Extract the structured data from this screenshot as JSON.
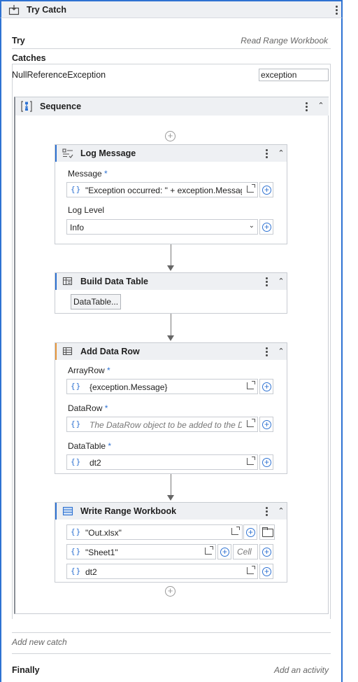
{
  "try_catch": {
    "title": "Try Catch",
    "icon": "try-catch-icon",
    "try_label": "Try",
    "try_activity": "Read Range Workbook",
    "catches_label": "Catches",
    "exception_type": "NullReferenceException",
    "exception_var": "exception",
    "add_new_catch": "Add new catch",
    "finally_label": "Finally",
    "finally_placeholder": "Add an activity"
  },
  "sequence": {
    "title": "Sequence",
    "icon": "sequence-icon"
  },
  "log_message": {
    "title": "Log Message",
    "icon": "log-message-icon",
    "message_label": "Message",
    "required_mark": "*",
    "message_value": "\"Exception occurred: \" + exception.Messag",
    "log_level_label": "Log Level",
    "log_level_value": "Info"
  },
  "build_data_table": {
    "title": "Build Data Table",
    "icon": "build-data-table-icon",
    "button_label": "DataTable..."
  },
  "add_data_row": {
    "title": "Add Data Row",
    "icon": "add-data-row-icon",
    "array_row_label": "ArrayRow",
    "array_row_value": "{exception.Message}",
    "data_row_label": "DataRow",
    "data_row_placeholder": "The DataRow object to be added to the Dat",
    "data_table_label": "DataTable",
    "data_table_value": "dt2",
    "required_mark": "*"
  },
  "write_range": {
    "title": "Write Range Workbook",
    "icon": "write-range-icon",
    "file_value": "\"Out.xlsx\"",
    "sheet_value": "\"Sheet1\"",
    "cell_placeholder": "Cell",
    "data_value": "dt2"
  },
  "colors": {
    "accent": "#2e72d2",
    "header_bg": "#eef0f3",
    "orange_marker": "#e8973b"
  }
}
